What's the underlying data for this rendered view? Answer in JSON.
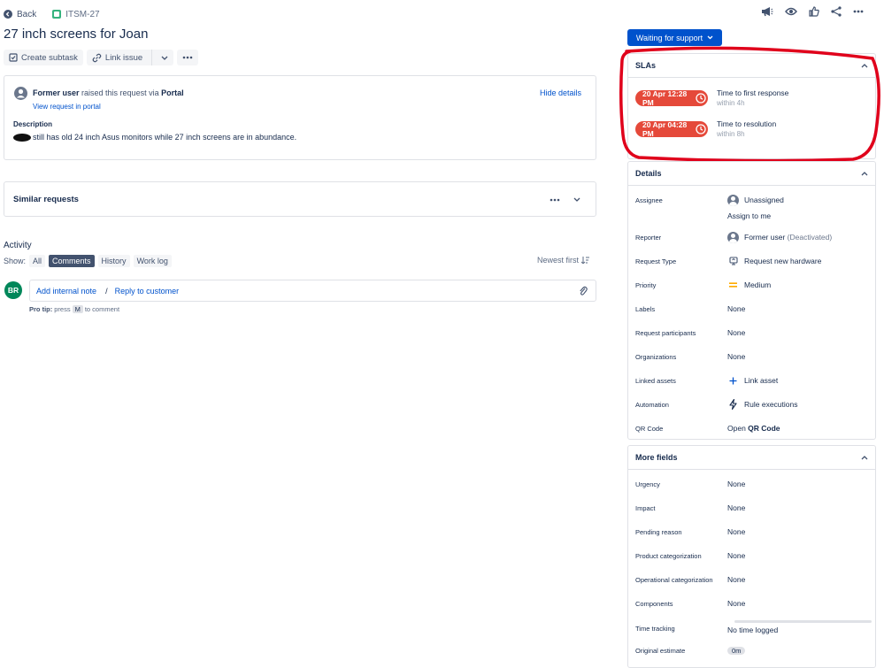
{
  "topbar": {
    "back_label": "Back",
    "issue_key": "ITSM-27"
  },
  "title": "27 inch screens for Joan",
  "toolbar": {
    "create_subtask": "Create subtask",
    "link_issue": "Link issue"
  },
  "request": {
    "reporter": "Former user",
    "raised_text": " raised this request via ",
    "channel": "Portal",
    "view_portal": "View request in portal",
    "hide_details": "Hide details",
    "description_label": "Description",
    "description_text": "still has old 24 inch Asus monitors while 27 inch screens are in abundance."
  },
  "similar": {
    "title": "Similar requests"
  },
  "activity": {
    "title": "Activity",
    "show_label": "Show:",
    "filters": [
      "All",
      "Comments",
      "History",
      "Work log"
    ],
    "active_filter": "Comments",
    "sort_label": "Newest first",
    "avatar_initials": "BR",
    "add_internal_note": "Add internal note",
    "separator": "/",
    "reply_to_customer": "Reply to customer",
    "protip_label": "Pro tip:",
    "protip_press": "press",
    "protip_key": "M",
    "protip_rest": "to comment"
  },
  "status": {
    "label": "Waiting for support"
  },
  "sla": {
    "title": "SLAs",
    "items": [
      {
        "time": "20 Apr 12:28 PM",
        "name": "Time to first response",
        "sub": "within 4h"
      },
      {
        "time": "20 Apr 04:28 PM",
        "name": "Time to resolution",
        "sub": "within 8h"
      }
    ],
    "accent": "#e5493a",
    "annotation_color": "#e0001b"
  },
  "details": {
    "title": "Details",
    "assignee_label": "Assignee",
    "assignee_value": "Unassigned",
    "assign_to_me": "Assign to me",
    "reporter_label": "Reporter",
    "reporter_value": "Former user",
    "reporter_note": "(Deactivated)",
    "request_type_label": "Request Type",
    "request_type_value": "Request new hardware",
    "priority_label": "Priority",
    "priority_value": "Medium",
    "labels_label": "Labels",
    "labels_value": "None",
    "participants_label": "Request participants",
    "participants_value": "None",
    "organizations_label": "Organizations",
    "organizations_value": "None",
    "linked_assets_label": "Linked assets",
    "linked_assets_value": "Link asset",
    "automation_label": "Automation",
    "automation_value": "Rule executions",
    "qr_label": "QR Code",
    "qr_open": "Open ",
    "qr_value": "QR Code"
  },
  "more_fields": {
    "title": "More fields",
    "rows": [
      {
        "label": "Urgency",
        "value": "None"
      },
      {
        "label": "Impact",
        "value": "None"
      },
      {
        "label": "Pending reason",
        "value": "None"
      },
      {
        "label": "Product categorization",
        "value": "None"
      },
      {
        "label": "Operational categorization",
        "value": "None"
      },
      {
        "label": "Components",
        "value": "None"
      }
    ],
    "time_tracking_label": "Time tracking",
    "time_tracking_value": "No time logged",
    "original_estimate_label": "Original estimate",
    "original_estimate_value": "0m"
  }
}
